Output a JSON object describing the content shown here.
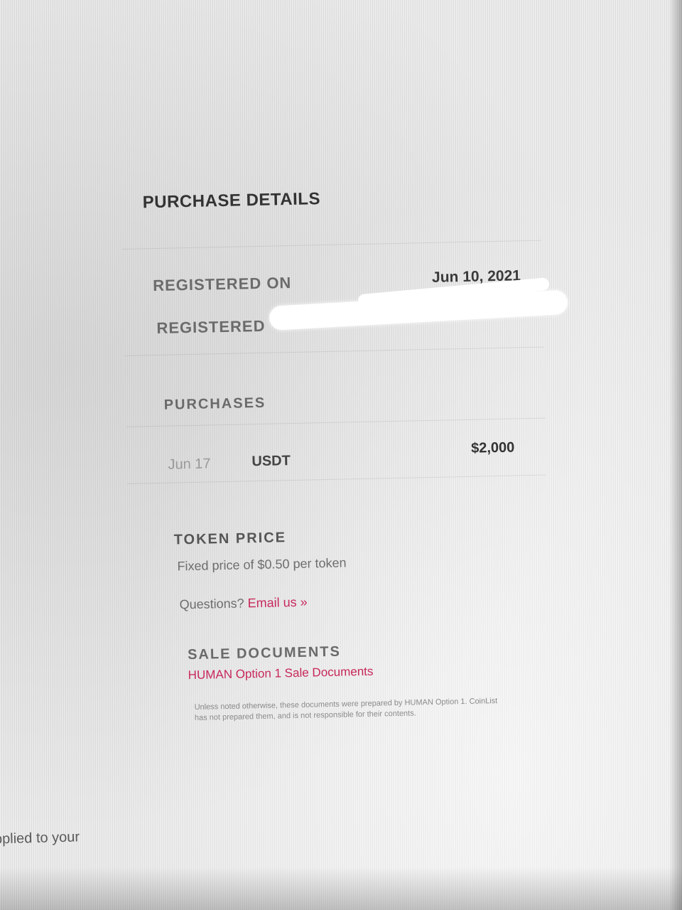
{
  "purchase_details": {
    "title": "PURCHASE DETAILS",
    "registered_on_label": "REGISTERED ON",
    "registered_on_value": "Jun 10, 2021",
    "registered_with_label": "REGISTERED"
  },
  "purchases": {
    "title": "PURCHASES",
    "items": [
      {
        "date": "Jun 17",
        "currency": "USDT",
        "amount": "$2,000"
      }
    ]
  },
  "token_price": {
    "title": "TOKEN PRICE",
    "description": "Fixed price of $0.50 per token",
    "questions_text": "Questions?",
    "email_link": "Email us »"
  },
  "sale_documents": {
    "title": "SALE DOCUMENTS",
    "link": "HUMAN Option 1 Sale Documents",
    "disclaimer": "Unless noted otherwise, these documents were prepared by HUMAN Option 1. CoinList has not prepared them, and is not responsible for their contents."
  },
  "background_text": "pplied to your"
}
